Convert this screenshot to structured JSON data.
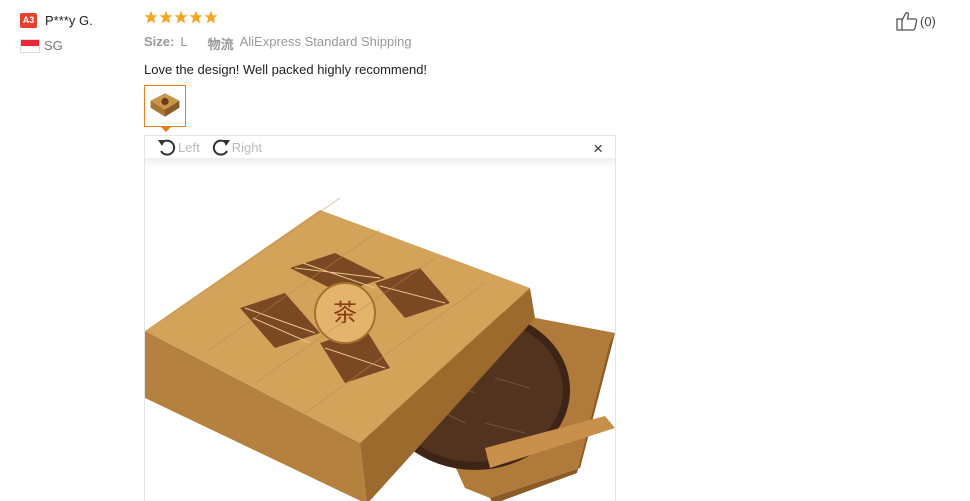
{
  "user": {
    "level": "A3",
    "name": "P***y G.",
    "country": "SG"
  },
  "review": {
    "rating": 5,
    "size_label": "Size:",
    "size_value": "L",
    "shipping_label": "物流",
    "shipping_value": "AliExpress Standard Shipping",
    "text": "Love the design! Well packed highly recommend!"
  },
  "viewer": {
    "rotate_left_label": "Left",
    "rotate_right_label": "Right",
    "close_symbol": "×"
  },
  "like": {
    "count": "(0)"
  },
  "colors": {
    "star": "#f6a623",
    "badge": "#e8402b",
    "thumb_border": "#e67e22"
  },
  "icons": [
    "star-icon",
    "thumbs-up-icon",
    "rotate-left-icon",
    "rotate-right-icon",
    "close-icon",
    "flag-sg-icon"
  ]
}
